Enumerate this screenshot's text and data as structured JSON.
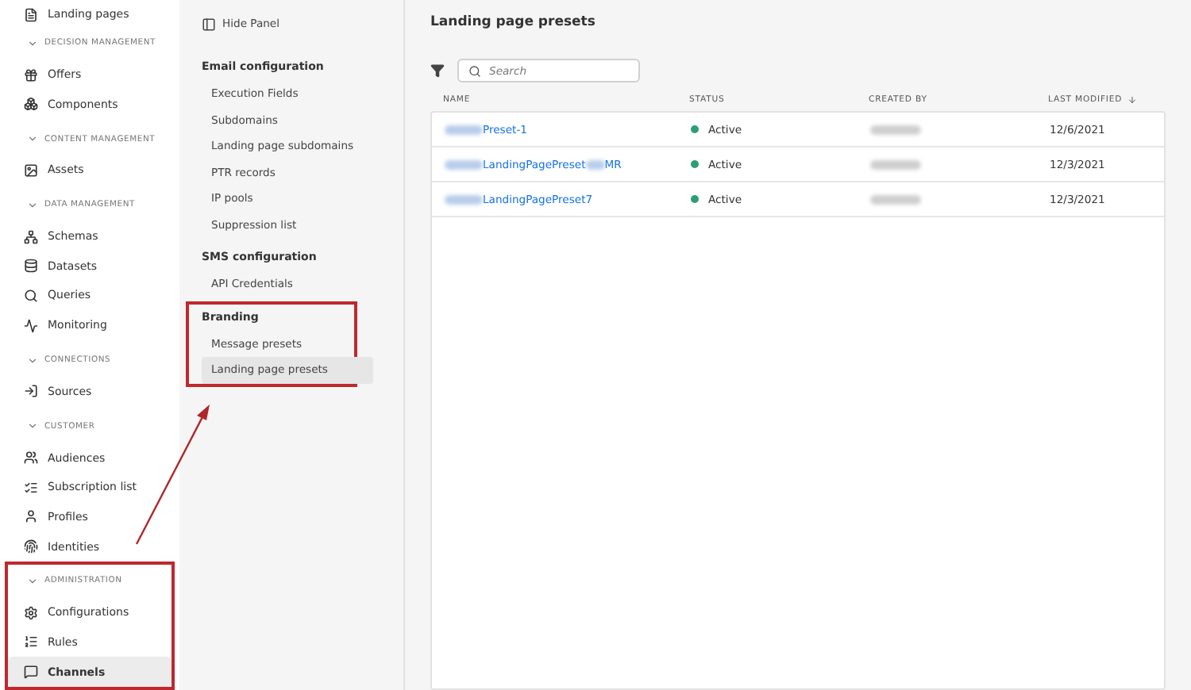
{
  "nav": [
    {
      "kind": "item",
      "label": "Landing pages",
      "selected": false
    },
    {
      "kind": "section",
      "label": "DECISION MANAGEMENT",
      "highlighted": false,
      "items": [
        {
          "label": "Offers",
          "selected": false
        },
        {
          "label": "Components",
          "selected": false
        }
      ]
    },
    {
      "kind": "section",
      "label": "CONTENT MANAGEMENT",
      "highlighted": false,
      "items": [
        {
          "label": "Assets",
          "selected": false
        }
      ]
    },
    {
      "kind": "section",
      "label": "DATA MANAGEMENT",
      "highlighted": false,
      "items": [
        {
          "label": "Schemas",
          "selected": false
        },
        {
          "label": "Datasets",
          "selected": false
        },
        {
          "label": "Queries",
          "selected": false
        },
        {
          "label": "Monitoring",
          "selected": false
        }
      ]
    },
    {
      "kind": "section",
      "label": "CONNECTIONS",
      "highlighted": false,
      "items": [
        {
          "label": "Sources",
          "selected": false
        }
      ]
    },
    {
      "kind": "section",
      "label": "CUSTOMER",
      "highlighted": false,
      "items": [
        {
          "label": "Audiences",
          "selected": false
        },
        {
          "label": "Subscription list",
          "selected": false
        },
        {
          "label": "Profiles",
          "selected": false
        },
        {
          "label": "Identities",
          "selected": false
        }
      ]
    },
    {
      "kind": "section",
      "label": "ADMINISTRATION",
      "highlighted": true,
      "items": [
        {
          "label": "Configurations",
          "selected": false
        },
        {
          "label": "Rules",
          "selected": false
        },
        {
          "label": "Channels",
          "selected": true
        }
      ]
    }
  ],
  "panel": {
    "hide_label": "Hide Panel",
    "groups": [
      {
        "title": "Email configuration",
        "highlighted": false,
        "items": [
          {
            "label": "Execution Fields",
            "selected": false
          },
          {
            "label": "Subdomains",
            "selected": false
          },
          {
            "label": "Landing page subdomains",
            "selected": false
          },
          {
            "label": "PTR records",
            "selected": false
          },
          {
            "label": "IP pools",
            "selected": false
          },
          {
            "label": "Suppression list",
            "selected": false
          }
        ]
      },
      {
        "title": "SMS configuration",
        "highlighted": false,
        "items": [
          {
            "label": "API Credentials",
            "selected": false
          }
        ]
      },
      {
        "title": "Branding",
        "highlighted": true,
        "items": [
          {
            "label": "Message presets",
            "selected": false
          },
          {
            "label": "Landing page presets",
            "selected": true
          }
        ]
      }
    ]
  },
  "main": {
    "title": "Landing page presets",
    "search": {
      "placeholder": "Search"
    },
    "table": {
      "columns": [
        {
          "label": "NAME",
          "sorted": false
        },
        {
          "label": "STATUS",
          "sorted": false
        },
        {
          "label": "CREATED BY",
          "sorted": false
        },
        {
          "label": "LAST MODIFIED",
          "sorted": true
        }
      ],
      "rows": [
        {
          "name": [
            {
              "kind": "redacted"
            },
            {
              "kind": "text",
              "text": "Preset-1"
            }
          ],
          "status": "Active",
          "created_by": [
            {
              "kind": "redacted"
            }
          ],
          "modified": "12/6/2021"
        },
        {
          "name": [
            {
              "kind": "redacted"
            },
            {
              "kind": "text",
              "text": "LandingPagePreset"
            },
            {
              "kind": "redacted"
            },
            {
              "kind": "text",
              "text": "MR"
            }
          ],
          "status": "Active",
          "created_by": [
            {
              "kind": "redacted"
            }
          ],
          "modified": "12/3/2021"
        },
        {
          "name": [
            {
              "kind": "redacted"
            },
            {
              "kind": "text",
              "text": "LandingPagePreset7"
            }
          ],
          "status": "Active",
          "created_by": [
            {
              "kind": "redacted"
            }
          ],
          "modified": "12/3/2021"
        }
      ]
    }
  }
}
